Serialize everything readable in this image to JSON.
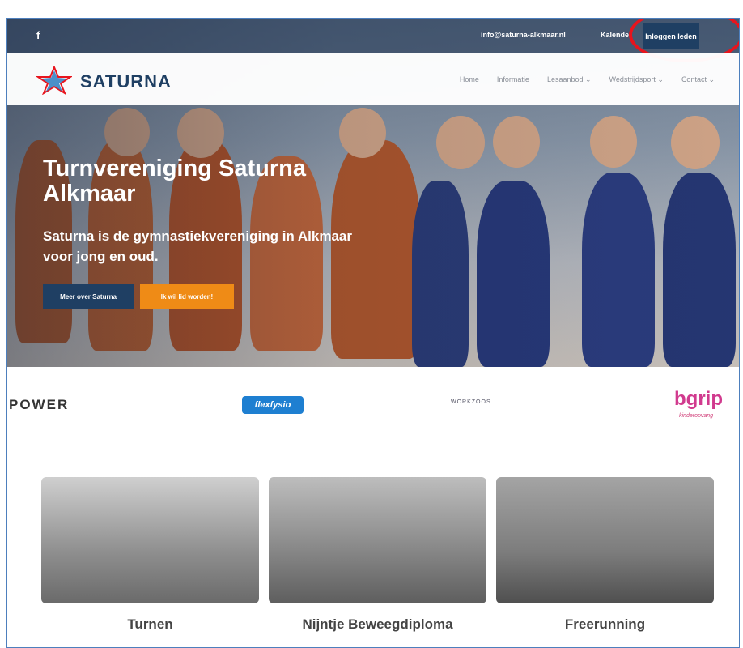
{
  "topbar": {
    "facebook": "f",
    "email": "info@saturna-alkmaar.nl",
    "calendar": "Kalender",
    "login": "Inloggen leden"
  },
  "nav": {
    "logo": "SATURNA",
    "items": [
      "Home",
      "Informatie",
      "Lesaanbod ⌄",
      "Wedstrijdsport ⌄",
      "Contact ⌄"
    ]
  },
  "hero": {
    "title": "Turnvereniging Saturna Alkmaar",
    "subtitle": "Saturna is de gymnastiekvereniging in Alkmaar voor jong en oud.",
    "button_primary": "Meer over Saturna",
    "button_secondary": "Ik wil lid worden!"
  },
  "sponsors": [
    "POWER",
    "flexfysio",
    "WORKZOOS",
    "bgrip",
    "kinderopvang"
  ],
  "cards": [
    {
      "label": "Turnen"
    },
    {
      "label": "Nijntje Beweegdiploma"
    },
    {
      "label": "Freerunning"
    }
  ],
  "colors": {
    "navy": "#1f3f63",
    "orange": "#ef8b16",
    "highlight": "#e8141d"
  }
}
